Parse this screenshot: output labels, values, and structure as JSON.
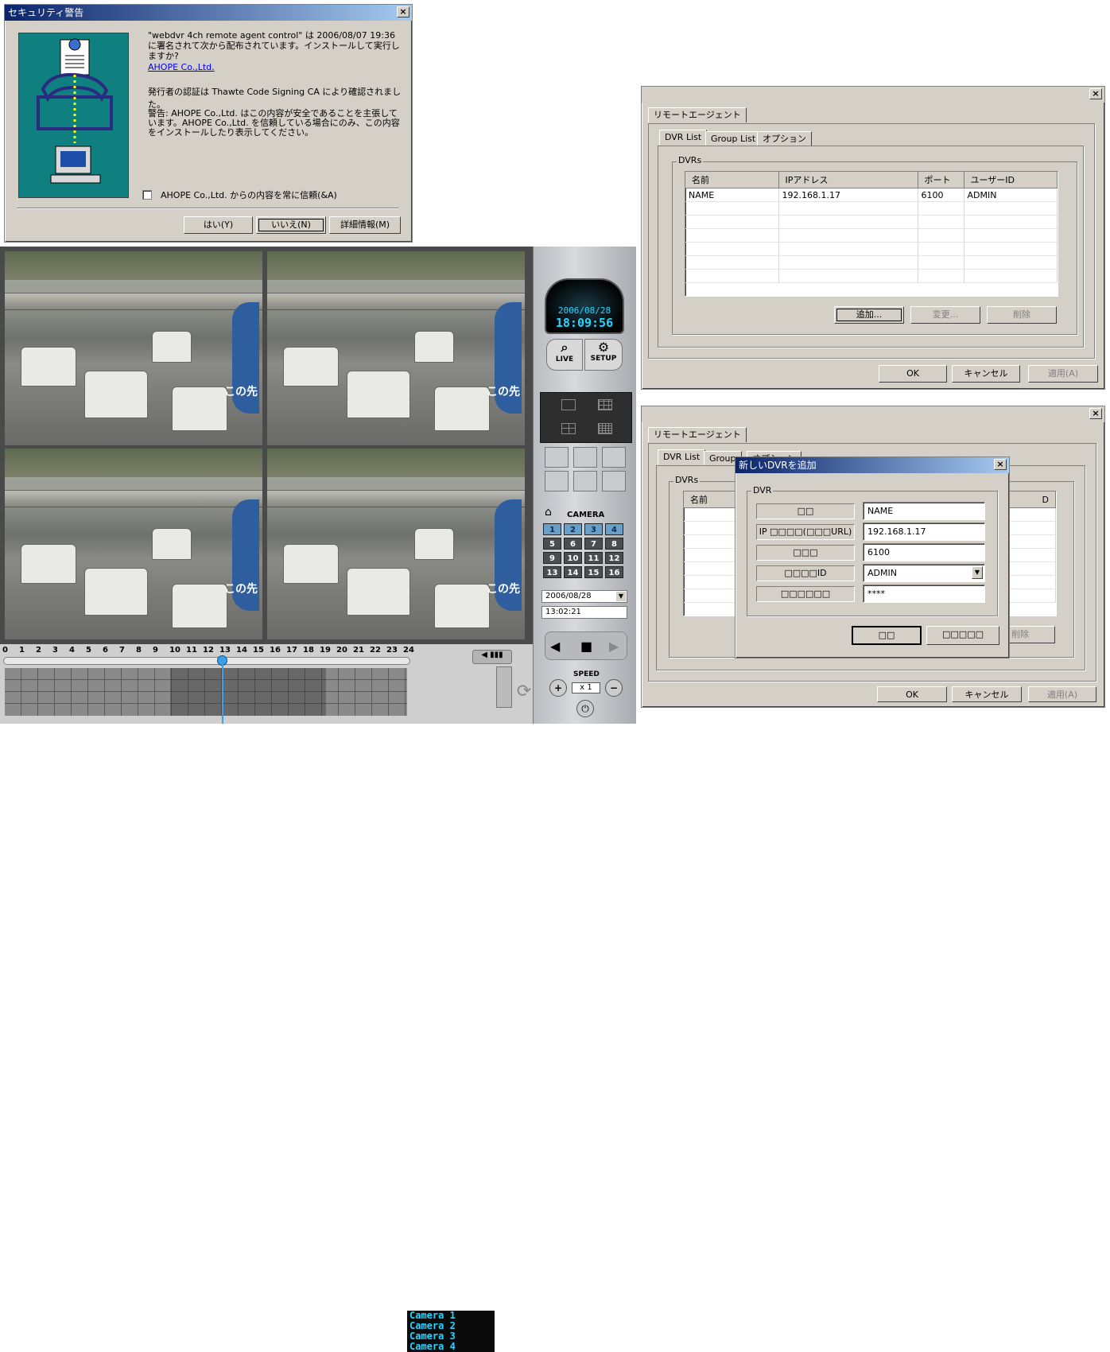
{
  "security_dialog": {
    "title": "セキュリティ警告",
    "close": "×",
    "line1": "\"webdvr 4ch remote agent control\" は 2006/08/07 19:36 に署名されて次から配布されています。インストールして実行しますか?",
    "publisher_link": "AHOPE Co.,Ltd.",
    "verified": "発行者の認証は Thawte Code Signing CA により確認されました。",
    "warning": "警告: AHOPE Co.,Ltd. はこの内容が安全であることを主張しています。AHOPE Co.,Ltd. を信頼している場合にのみ、この内容をインストールしたり表示してください。",
    "trust_checkbox": "AHOPE Co.,Ltd. からの内容を常に信頼(&A)",
    "yes": "はい(Y)",
    "no": "いいえ(N)",
    "details": "詳細情報(M)"
  },
  "remote_agent_1": {
    "close": "×",
    "outer_tab": "リモートエージェント",
    "tabs": [
      "DVR List",
      "Group List",
      "オプション"
    ],
    "group_label": "DVRs",
    "columns": [
      "名前",
      "IPアドレス",
      "ポート",
      "ユーザーID"
    ],
    "rows": [
      [
        "NAME",
        "192.168.1.17",
        "6100",
        "ADMIN"
      ]
    ],
    "add": "追加...",
    "change": "変更...",
    "delete": "削除",
    "ok": "OK",
    "cancel": "キャンセル",
    "apply": "適用(A)"
  },
  "remote_agent_2": {
    "close": "×",
    "outer_tab": "リモートエージェント",
    "tabs": [
      "DVR List",
      "Group"
    ],
    "tab_partial": "オプション",
    "group_label": "DVRs",
    "col_name": "名前",
    "col_partial": "D",
    "delete": "削除",
    "ok": "OK",
    "cancel": "キャンセル",
    "apply": "適用(A)"
  },
  "add_dvr_dialog": {
    "title": "新しいDVRを追加",
    "close": "×",
    "group_label": "DVR",
    "labels": [
      "□□",
      "IP □□□□(□□□URL)",
      "□□□",
      "□□□□ID",
      "□□□□□□"
    ],
    "values": [
      "NAME",
      "192.168.1.17",
      "6100",
      "ADMIN",
      "****"
    ],
    "ok": "□□",
    "cancel": "□□□□□"
  },
  "dvr_viewer": {
    "date": "2006/08/28",
    "clock": "18:09:56",
    "live": "LIVE",
    "setup": "SETUP",
    "camera_label": "CAMERA",
    "cameras": [
      "1",
      "2",
      "3",
      "4",
      "5",
      "6",
      "7",
      "8",
      "9",
      "10",
      "11",
      "12",
      "13",
      "14",
      "15",
      "16"
    ],
    "active_cameras": 4,
    "search_date": "2006/08/28",
    "search_time": "13:02:21",
    "speed_label": "SPEED",
    "speed_value": "x 1",
    "timeline_hours": [
      "0",
      "1",
      "2",
      "3",
      "4",
      "5",
      "6",
      "7",
      "8",
      "9",
      "10",
      "11",
      "12",
      "13",
      "14",
      "15",
      "16",
      "17",
      "18",
      "19",
      "20",
      "21",
      "22",
      "23",
      "24"
    ],
    "camera_list": [
      "Camera 1",
      "Camera 2",
      "Camera 3",
      "Camera 4"
    ],
    "overlay_text": "この先"
  }
}
